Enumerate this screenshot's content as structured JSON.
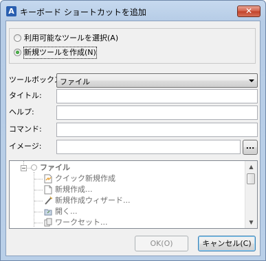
{
  "window": {
    "title": "キーボード ショートカットを追加",
    "close_glyph": "✕",
    "app_icon_glyph": "A"
  },
  "source_options": [
    {
      "label": "利用可能なツールを選択(A)",
      "selected": false
    },
    {
      "label": "新規ツールを作成(N)",
      "selected": true
    }
  ],
  "form": {
    "toolbox_label": "ツールボックス:",
    "toolbox_value": "ファイル",
    "title_label": "タイトル:",
    "title_value": "",
    "help_label": "ヘルプ:",
    "help_value": "",
    "command_label": "コマンド:",
    "command_value": "",
    "image_label": "イメージ:",
    "image_value": "",
    "browse_label": "..."
  },
  "tree": {
    "root": "ファイル",
    "items": [
      {
        "label": "クイック新規作成",
        "icon": "quick-new-icon"
      },
      {
        "label": "新規作成...",
        "icon": "new-document-icon"
      },
      {
        "label": "新規作成ウィザード...",
        "icon": "wizard-icon"
      },
      {
        "label": "開く...",
        "icon": "open-folder-icon"
      },
      {
        "label": "ワークセット...",
        "icon": "workset-icon"
      }
    ]
  },
  "buttons": {
    "ok": "OK(O)",
    "cancel": "キャンセル(C)"
  },
  "colors": {
    "titlebar": "#c6d9ef",
    "close": "#c24129",
    "client": "#f0f0f0"
  }
}
